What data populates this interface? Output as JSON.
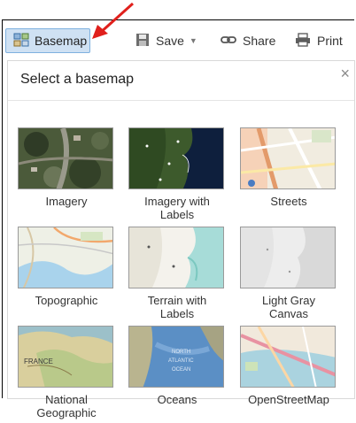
{
  "toolbar": {
    "basemap_label": "Basemap",
    "save_label": "Save",
    "share_label": "Share",
    "print_label": "Print"
  },
  "panel": {
    "title": "Select a basemap",
    "close_glyph": "×"
  },
  "basemaps": [
    {
      "label": "Imagery"
    },
    {
      "label": "Imagery with\nLabels"
    },
    {
      "label": "Streets"
    },
    {
      "label": "Topographic"
    },
    {
      "label": "Terrain with\nLabels"
    },
    {
      "label": "Light Gray\nCanvas"
    },
    {
      "label": "National\nGeographic"
    },
    {
      "label": "Oceans"
    },
    {
      "label": "OpenStreetMap"
    }
  ],
  "colors": {
    "selected_bg": "#cfe1f3",
    "selected_border": "#7fb1df",
    "arrow": "#e0201c"
  },
  "icons": [
    "basemap-grid-icon",
    "save-disk-icon",
    "share-link-icon",
    "print-icon",
    "close-icon",
    "annotation-arrow"
  ]
}
